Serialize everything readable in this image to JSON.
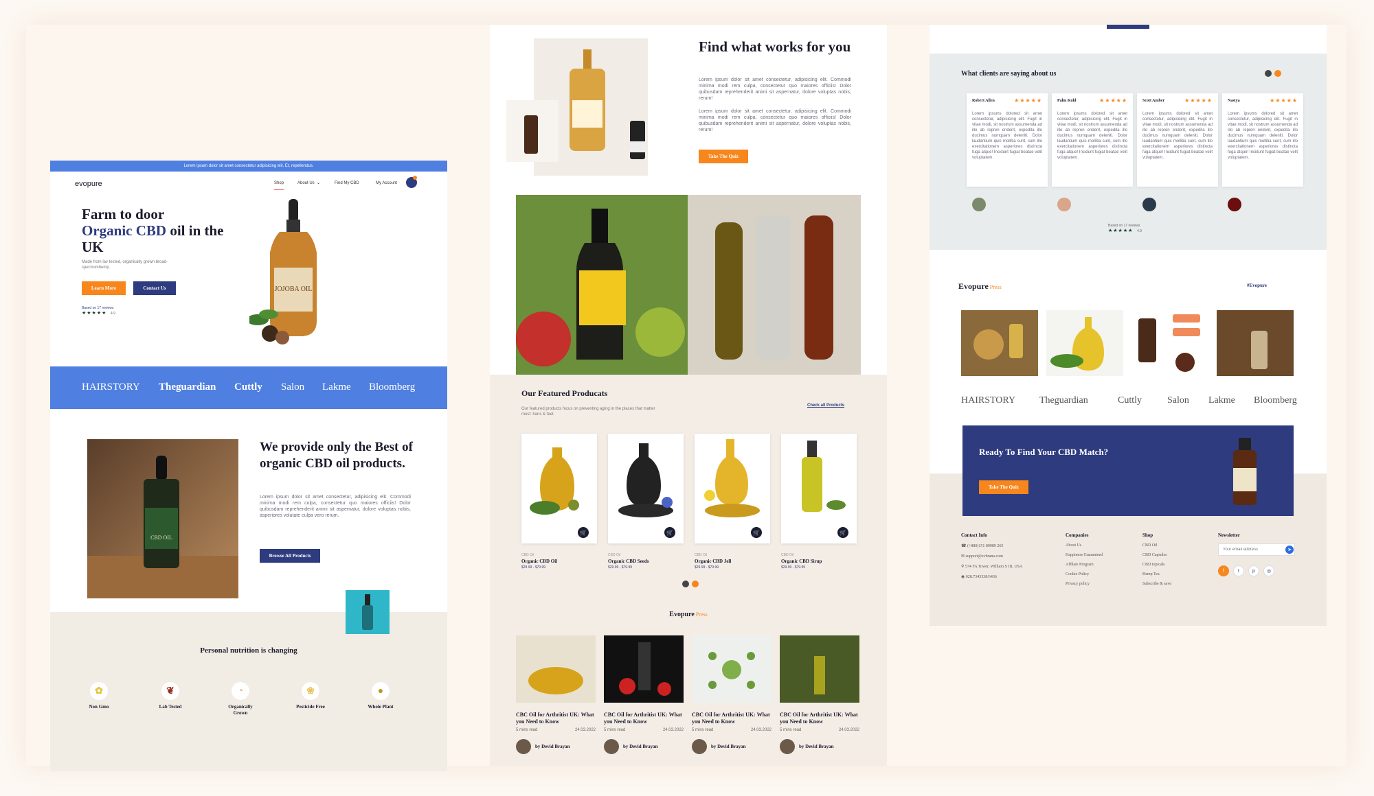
{
  "colors": {
    "accent": "#f7861c",
    "navy": "#2e3b7e",
    "blue": "#4f7fe0",
    "beige": "#f1ece4"
  },
  "p1": {
    "topbar": "Lorem ipsum dolor sit amet consectetur adipisicing elit. Et, repellendus.",
    "logo": "evopure",
    "nav": [
      "Shop",
      "About Us",
      "Find My CBD",
      "My Account"
    ],
    "hero_l1": "Farm to door",
    "hero_hl": "Organic CBD",
    "hero_l2": " oil in the UK",
    "hero_sub": "Made from lav tested, organically grown broad-spectrumhemp.",
    "learn_btn": "Learn More",
    "contact_btn": "Contact Us",
    "reviews": "Based on 17 reviews",
    "rating": "4.9",
    "brands": [
      "HAIRSTORY",
      "Theguardian",
      "Cuttly",
      "Salon",
      "Lakme",
      "Bloomberg"
    ],
    "provide_title": "We provide only the Best of organic CBD oil products.",
    "provide_body": "Lorem ipsum dolor sit amet consectetur, adipisicing elit. Commodi minima modi rem culpa, consectetur quo maiores officiis! Dolor quibusdam reprehenderit animi sit aspernatur, dolore voluptas nobis, asperiores volutate culpa vero rerum.",
    "browse_btn": "Browse All Products",
    "nutr_title": "Personal nutrition is changing",
    "features": [
      "Non Gmo",
      "Lab Tested",
      "Organically Grown",
      "Pesticide Free",
      "Whole Plant"
    ]
  },
  "p2": {
    "find_title": "Find what works for you",
    "find_p1": "Lorem ipsum dolor sit amet consectetur, adipisicing elit. Commodi minima modi rem culpa, consectetur quo maiores officiis! Dolor quibusdam reprehenderit animi sit aspernatur, dolore voluptas nobis, rerum!",
    "find_p2": "Lorem ipsum dolor sit amet consectetur, adipisicing elit. Commodi minima modi rem culpa, consectetur quo maiores officiis! Dolor quibusdam reprehenderit animi sit aspernatur, dolore voluptas nobis, rerum!",
    "quiz_btn": "Take The Quiz",
    "featured_title": "Our Featured Producats",
    "featured_sub": "Our featured products focus on preventing aging in the places that matter most: hans & feet.",
    "check_all": "Check all Products",
    "products": [
      {
        "cat": "CBD Oil",
        "name": "Organic CBD Oil",
        "price": "$29.99 - $79.99"
      },
      {
        "cat": "CBD Oil",
        "name": "Organic CBD Seeds",
        "price": "$29.99 - $79.99"
      },
      {
        "cat": "CBD Oil",
        "name": "Organic CBD Jell",
        "price": "$29.99 - $79.99"
      },
      {
        "cat": "CBD Oil",
        "name": "Organic CBD Sirup",
        "price": "$29.99 - $79.99"
      }
    ],
    "press_a": "Evopure",
    "press_b": " Press",
    "blogs": [
      {
        "title": "CBC Oil for Arthritist UK: What you Need to Know",
        "read": "5 mins read",
        "date": "24.03.2022",
        "author": "by Devid Brayan"
      },
      {
        "title": "CBC Oil for Arthritist UK: What you Need to Know",
        "read": "5 mins read",
        "date": "24.03.2022",
        "author": "by Devid Brayan"
      },
      {
        "title": "CBC Oil for Arthritist UK: What you Need to Know",
        "read": "5 mins read",
        "date": "24.03.2022",
        "author": "by Devid Brayan"
      },
      {
        "title": "CBC Oil for Arthritist UK: What you Need to Know",
        "read": "5 mins read",
        "date": "24.03.2022",
        "author": "by Devid Brayan"
      }
    ]
  },
  "p3": {
    "testi_title": "What clients are saying about us",
    "testimonials": [
      {
        "name": "Robert Allen",
        "text": "Lorem ipsums dolored sit amet consectetur, adipisicing elit. Fugit in vitae modi, sit nostrum assumenda ad illo ab repren enderit, expedita illo ducimus numquam deleniti. Dolor laudantium quis mollitia sunt, cum illo exercitationem asperiores distincta fuga atque! Incidunt fugiat beatae velit voluptatem."
      },
      {
        "name": "Palm Kold",
        "text": "Lorem ipsums dolored sit amet consectetur, adipisicing elit. Fugit in vitae modi, sit nostrum assumenda ad illo ab repren enderit, expedita illo ducimus numquam deleniti. Dolor laudantium quis mollitia sunt, cum illo exercitationem asperiores distincta fuga atque! Incidunt fugiat beatae velit voluptatem."
      },
      {
        "name": "Scott Amber",
        "text": "Lorem ipsums dolored sit amet consectetur, adipisicing elit. Fugit in vitae modi, sit nostrum assumenda ad illo ab repren enderit, expedita illo ducimus numquam deleniti. Dolor laudantium quis mollitia sunt, cum illo exercitationem asperiores distincta fuga atque! Incidunt fugiat beatae velit voluptatem."
      },
      {
        "name": "Nastya",
        "text": "Lorem ipsums dolored sit amet consectetur, adipisicing elit. Fugit in vitae modi, sit nostrum assumenda ad illo ab repren enderit, expedita illo ducimus numquam deleniti. Dolor laudantium quis mollitia sunt, cum illo exercitationem asperiores distincta fuga atque! Incidunt fugiat beatae velit voluptatem."
      }
    ],
    "reviews": "Based on 17 reviews",
    "rating": "4.9",
    "press_a": "Evopure",
    "press_b": " Press",
    "hashtag": "#Evopure",
    "brands": [
      "HAIRSTORY",
      "Theguardian",
      "Cuttly",
      "Salon",
      "Lakme",
      "Bloomberg"
    ],
    "cta_title": "Ready To Find Your CBD Match?",
    "cta_btn": "Take The Quiz",
    "contact_title": "Contact Info",
    "contact": [
      "(+880)151 89989 265",
      "support@evbrana.com",
      "574 FA Tower, William S III, USA",
      "028.7343338/6436"
    ],
    "companies_title": "Companies",
    "companies": [
      "About Us",
      "Happiness Guaranteed",
      "Affilate Program",
      "Cookie Policy",
      "Privacy policy"
    ],
    "shop_title": "Shop",
    "shop": [
      "CBD Oil",
      "CBD Capsules",
      "CBD topicals",
      "Hemp Tea",
      "Subscribe & save"
    ],
    "newsletter_title": "Newsletter",
    "newsletter_placeholder": "Your email address"
  }
}
